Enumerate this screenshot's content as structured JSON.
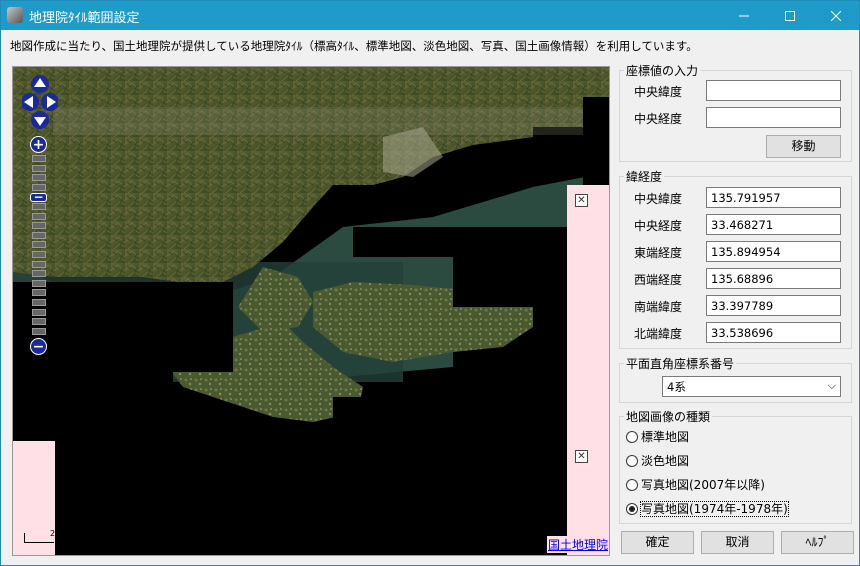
{
  "window": {
    "title": "地理院ﾀｲﾙ範囲設定",
    "minimize_icon": "minimize-icon",
    "maximize_icon": "maximize-icon",
    "close_icon": "close-icon"
  },
  "notice": "地図作成に当たり、国土地理院が提供している地理院ﾀｲﾙ（標高ﾀｲﾙ、標準地図、淡色地図、写真、国土画像情報）を利用しています。",
  "map": {
    "attribution_link": "国土地理院",
    "scale_label": "2",
    "colors": {
      "water": "#1f3f3a",
      "land": "#5a6b2a",
      "nodata": "#000000",
      "pink": "#ffe0e6"
    }
  },
  "coord_input": {
    "title": "座標値の入力",
    "lat_label": "中央緯度",
    "lon_label": "中央経度",
    "lat_value": "",
    "lon_value": "",
    "move_button": "移動"
  },
  "latlon": {
    "title": "緯経度",
    "rows": [
      {
        "label": "中央緯度",
        "value": "135.791957"
      },
      {
        "label": "中央経度",
        "value": "33.468271"
      },
      {
        "label": "東端経度",
        "value": "135.894954"
      },
      {
        "label": "西端経度",
        "value": "135.68896"
      },
      {
        "label": "南端緯度",
        "value": "33.397789"
      },
      {
        "label": "北端緯度",
        "value": "33.538696"
      }
    ]
  },
  "plane": {
    "title": "平面直角座標系番号",
    "selected": "4系"
  },
  "image_type": {
    "title": "地図画像の種類",
    "options": [
      {
        "label": "標準地図",
        "checked": false
      },
      {
        "label": "淡色地図",
        "checked": false
      },
      {
        "label": "写真地図(2007年以降)",
        "checked": false
      },
      {
        "label": "写真地図(1974年-1978年)",
        "checked": true
      }
    ]
  },
  "footer": {
    "ok": "確定",
    "cancel": "取消",
    "help": "ﾍﾙﾌﾟ"
  }
}
